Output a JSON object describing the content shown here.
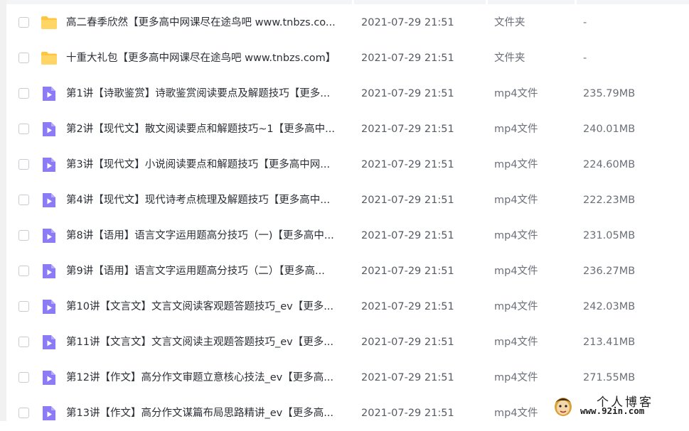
{
  "files": [
    {
      "name": "高二春季欣然【更多高中网课尽在途鸟吧 www.tnbzs.co...",
      "date": "2021-07-29 21:51",
      "type": "文件夹",
      "size": "-",
      "icon": "folder-icon"
    },
    {
      "name": "十重大礼包【更多高中网课尽在途鸟吧 www.tnbzs.com】",
      "date": "2021-07-29 21:51",
      "type": "文件夹",
      "size": "-",
      "icon": "folder-icon"
    },
    {
      "name": "第1讲【诗歌鉴赏】诗歌鉴赏阅读要点及解题技巧【更多...",
      "date": "2021-07-29 21:51",
      "type": "mp4文件",
      "size": "235.79MB",
      "icon": "video-file-icon"
    },
    {
      "name": "第2讲【现代文】散文阅读要点和解题技巧~1【更多高中...",
      "date": "2021-07-29 21:51",
      "type": "mp4文件",
      "size": "240.01MB",
      "icon": "video-file-icon"
    },
    {
      "name": "第3讲【现代文】小说阅读要点和解题技巧【更多高中网...",
      "date": "2021-07-29 21:51",
      "type": "mp4文件",
      "size": "224.60MB",
      "icon": "video-file-icon"
    },
    {
      "name": "第4讲【现代文】现代诗考点梳理及解题技巧【更多高中...",
      "date": "2021-07-29 21:51",
      "type": "mp4文件",
      "size": "222.23MB",
      "icon": "video-file-icon"
    },
    {
      "name": "第8讲【语用】语言文字运用题高分技巧（一)【更多高中...",
      "date": "2021-07-29 21:51",
      "type": "mp4文件",
      "size": "231.05MB",
      "icon": "video-file-icon"
    },
    {
      "name": "第9讲【语用】语言文字运用题高分技巧（二）【更多高...",
      "date": "2021-07-29 21:51",
      "type": "mp4文件",
      "size": "236.27MB",
      "icon": "video-file-icon"
    },
    {
      "name": "第10讲【文言文】文言文阅读客观题答题技巧_ev【更多...",
      "date": "2021-07-29 21:51",
      "type": "mp4文件",
      "size": "242.03MB",
      "icon": "video-file-icon"
    },
    {
      "name": "第11讲【文言文】文言文阅读主观题答题技巧_ev【更多...",
      "date": "2021-07-29 21:51",
      "type": "mp4文件",
      "size": "213.41MB",
      "icon": "video-file-icon"
    },
    {
      "name": "第12讲【作文】高分作文审题立意核心技法_ev【更多高...",
      "date": "2021-07-29 21:51",
      "type": "mp4文件",
      "size": "271.55MB",
      "icon": "video-file-icon"
    },
    {
      "name": "第13讲【作文】高分作文谋篇布局思路精讲_ev【更多高...",
      "date": "2021-07-29 21:51",
      "type": "mp4文件",
      "size": "",
      "icon": "video-file-icon"
    }
  ],
  "watermark": {
    "title": "个人博客",
    "url": "www.92in.com"
  },
  "colors": {
    "folder": "#ffc53d",
    "video": "#8b7cf6",
    "checkbox_border": "#c8cbd1"
  }
}
